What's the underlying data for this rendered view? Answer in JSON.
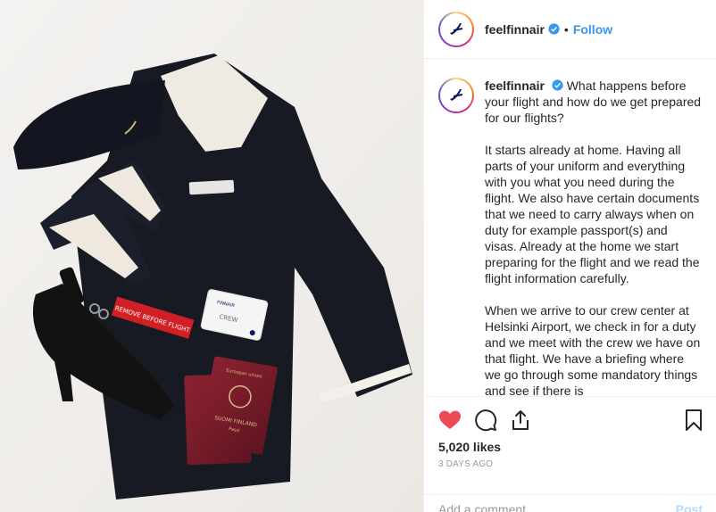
{
  "post": {
    "username": "feelfinnair",
    "follow_label": "Follow",
    "dot": "•",
    "caption_paragraphs": [
      "What happens before your flight and how do we get prepared for our flights?",
      "It starts already at home. Having all parts of your uniform and everything with you what you need during the flight. We also have certain documents that we need to carry always when on duty for example passport(s) and visas. Already at the home we start preparing for the flight and we read the flight information carefully.",
      "When we arrive to our crew center at Helsinki Airport, we check in for a duty and we meet with the crew we have on that flight. We have a briefing where we go through some mandatory things and see if there is"
    ],
    "likes": "5,020 likes",
    "time": "3 DAYS AGO",
    "comment_placeholder": "Add a comment...",
    "post_label": "Post"
  },
  "photo": {
    "tag_text": "REMOVE BEFORE FLIGHT",
    "crew_card_text": "CREW",
    "crew_card_brand": "FINNAIR",
    "passport_text": "SUOMI FINLAND",
    "passport_sub": "Passi",
    "passport_top": "Euroopan unioni"
  },
  "colors": {
    "like_red": "#ed4956",
    "link_blue": "#3897f0",
    "finnair_blue": "#0b1560"
  },
  "icons": [
    "heart-icon",
    "comment-icon",
    "share-icon",
    "bookmark-icon",
    "verified-badge-icon",
    "finnair-logo-icon"
  ]
}
